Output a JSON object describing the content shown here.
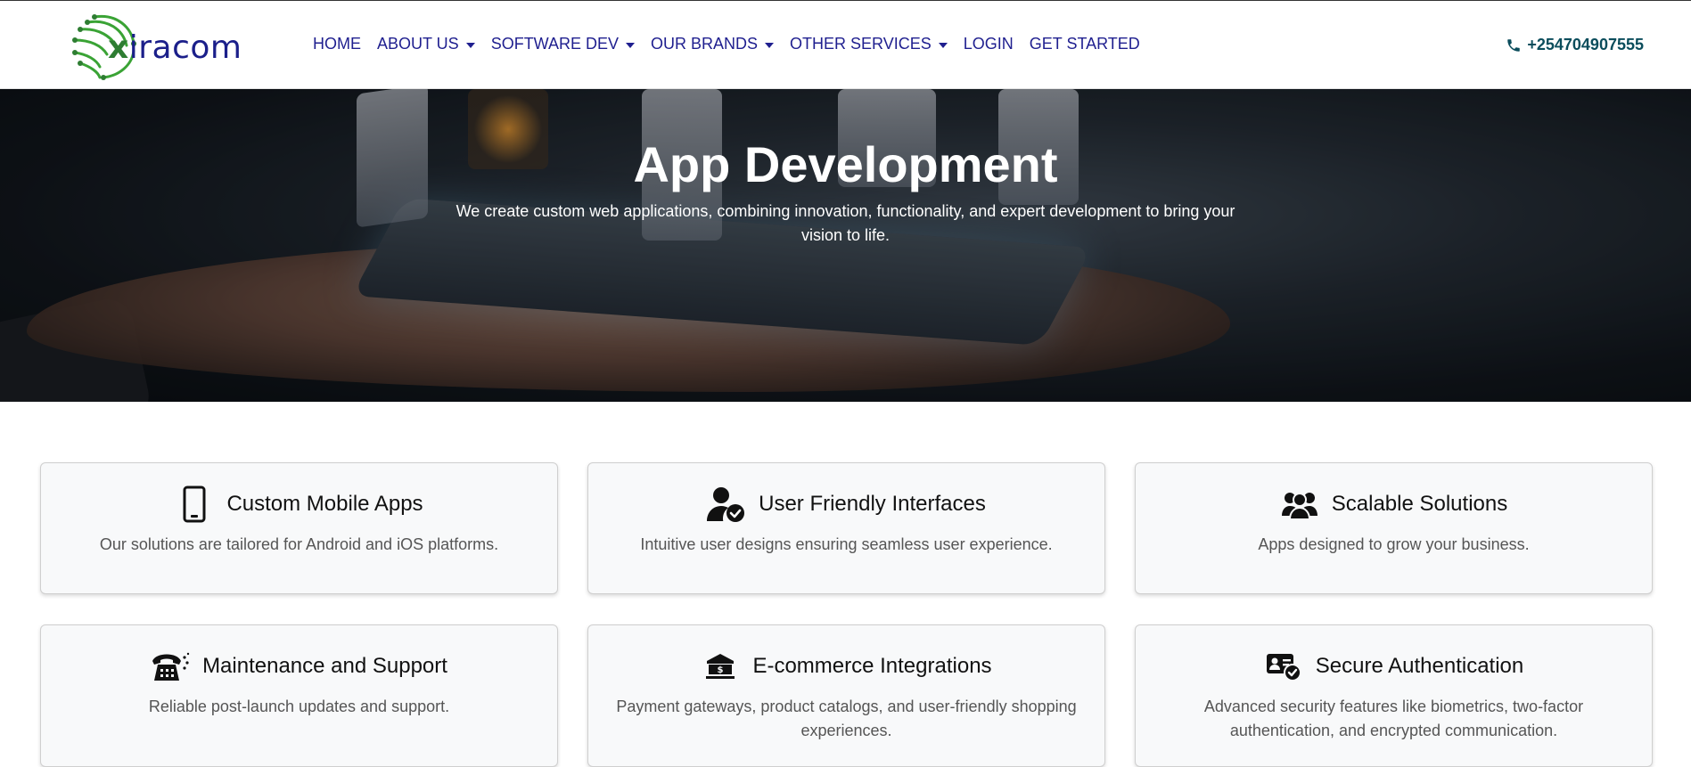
{
  "brand": {
    "logo_x": "x",
    "logo_rest": "iracom"
  },
  "nav": {
    "items": [
      {
        "label": "HOME",
        "dropdown": false
      },
      {
        "label": "ABOUT US",
        "dropdown": true
      },
      {
        "label": "SOFTWARE DEV",
        "dropdown": true
      },
      {
        "label": "OUR BRANDS",
        "dropdown": true
      },
      {
        "label": "OTHER SERVICES",
        "dropdown": true
      },
      {
        "label": "LOGIN",
        "dropdown": false
      },
      {
        "label": "GET STARTED",
        "dropdown": false
      }
    ],
    "phone": "+254704907555"
  },
  "hero": {
    "title": "App Development",
    "subtitle": "We create custom web applications, combining innovation, functionality, and expert development to bring your vision to life."
  },
  "features": [
    {
      "icon": "mobile-phone-icon",
      "title": "Custom Mobile Apps",
      "text": "Our solutions are tailored for Android and iOS platforms."
    },
    {
      "icon": "user-check-icon",
      "title": "User Friendly Interfaces",
      "text": "Intuitive user designs ensuring seamless user experience."
    },
    {
      "icon": "users-group-icon",
      "title": "Scalable Solutions",
      "text": "Apps designed to grow your business."
    },
    {
      "icon": "telephone-support-icon",
      "title": "Maintenance and Support",
      "text": "Reliable post-launch updates and support."
    },
    {
      "icon": "bank-ecommerce-icon",
      "title": "E-commerce Integrations",
      "text": "Payment gateways, product catalogs, and user-friendly shopping experiences."
    },
    {
      "icon": "id-card-check-icon",
      "title": "Secure Authentication",
      "text": "Advanced security features like biometrics, two-factor authentication, and encrypted communication."
    }
  ],
  "colors": {
    "nav_text": "#1f1f8f",
    "phone_text": "#0b4d5c",
    "logo_green": "#2e7d32",
    "logo_blue": "#1b1f8a"
  }
}
